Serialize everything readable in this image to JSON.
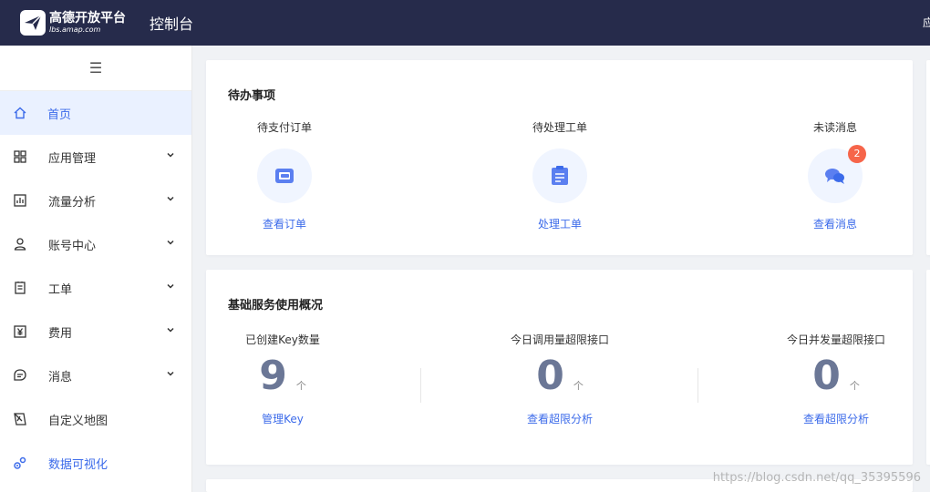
{
  "header": {
    "logo_cn": "高德开放平台",
    "logo_en": "lbs.amap.com",
    "console": "控制台",
    "right_text": "应"
  },
  "sidebar": {
    "collapse_icon": "menu-icon",
    "items": [
      {
        "label": "首页",
        "icon": "home-icon",
        "active": true
      },
      {
        "label": "应用管理",
        "icon": "grid-icon",
        "expandable": true
      },
      {
        "label": "流量分析",
        "icon": "chart-icon",
        "expandable": true
      },
      {
        "label": "账号中心",
        "icon": "user-icon",
        "expandable": true
      },
      {
        "label": "工单",
        "icon": "ticket-icon",
        "expandable": true
      },
      {
        "label": "费用",
        "icon": "yen-icon",
        "expandable": true
      },
      {
        "label": "消息",
        "icon": "message-icon",
        "expandable": true
      },
      {
        "label": "自定义地图",
        "icon": "map-icon"
      },
      {
        "label": "数据可视化",
        "icon": "visual-icon"
      }
    ]
  },
  "todo": {
    "title": "待办事项",
    "items": [
      {
        "label": "待支付订单",
        "action": "查看订单",
        "icon": "wallet-icon"
      },
      {
        "label": "待处理工单",
        "action": "处理工单",
        "icon": "clipboard-icon"
      },
      {
        "label": "未读消息",
        "action": "查看消息",
        "icon": "chat-icon",
        "badge": "2"
      }
    ]
  },
  "usage": {
    "title": "基础服务使用概况",
    "items": [
      {
        "label": "已创建Key数量",
        "value": "9",
        "unit": "个",
        "action": "管理Key"
      },
      {
        "label": "今日调用量超限接口",
        "value": "0",
        "unit": "个",
        "action": "查看超限分析"
      },
      {
        "label": "今日并发量超限接口",
        "value": "0",
        "unit": "个",
        "action": "查看超限分析"
      }
    ]
  },
  "watermark": "https://blog.csdn.net/qq_35395596",
  "colors": {
    "header_bg": "#262b4b",
    "accent": "#3c6bea",
    "badge": "#f6654a",
    "number": "#6b7796"
  }
}
